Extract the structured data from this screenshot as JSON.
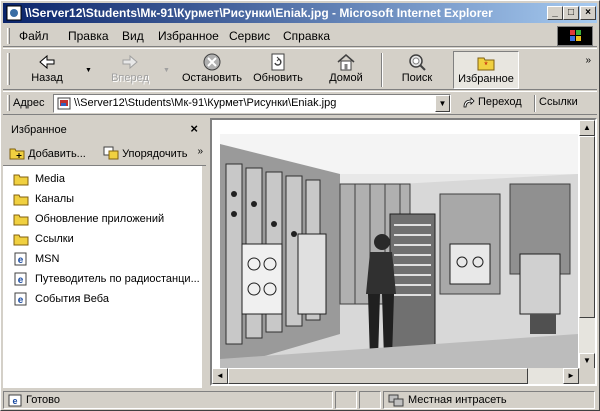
{
  "window": {
    "title": "\\\\Server12\\Students\\Мк-91\\Курмет\\Рисунки\\Eniak.jpg - Microsoft Internet Explorer"
  },
  "menu": [
    "Файл",
    "Правка",
    "Вид",
    "Избранное",
    "Сервис",
    "Справка"
  ],
  "toolbar": {
    "back": "Назад",
    "forward": "Вперед",
    "stop": "Остановить",
    "refresh": "Обновить",
    "home": "Домой",
    "search": "Поиск",
    "favorites": "Избранное"
  },
  "address": {
    "label": "Адрес",
    "value": "\\\\Server12\\Students\\Мк-91\\Курмет\\Рисунки\\Eniak.jpg",
    "go": "Переход",
    "links": "Ссылки"
  },
  "favorites_panel": {
    "title": "Избранное",
    "add": "Добавить...",
    "organize": "Упорядочить",
    "items": [
      {
        "label": "Media",
        "icon": "folder-icon"
      },
      {
        "label": "Каналы",
        "icon": "folder-icon"
      },
      {
        "label": "Обновление приложений",
        "icon": "folder-icon"
      },
      {
        "label": "Ссылки",
        "icon": "folder-icon"
      },
      {
        "label": "MSN",
        "icon": "ie-link-icon"
      },
      {
        "label": "Путеводитель по радиостанци...",
        "icon": "ie-link-icon"
      },
      {
        "label": "События Веба",
        "icon": "ie-link-icon"
      }
    ]
  },
  "status": {
    "text": "Готово",
    "zone": "Местная интрасеть"
  },
  "colors": {
    "titlebar_start": "#0a246a",
    "titlebar_end": "#a6caf0",
    "chrome": "#d4d0c8"
  }
}
